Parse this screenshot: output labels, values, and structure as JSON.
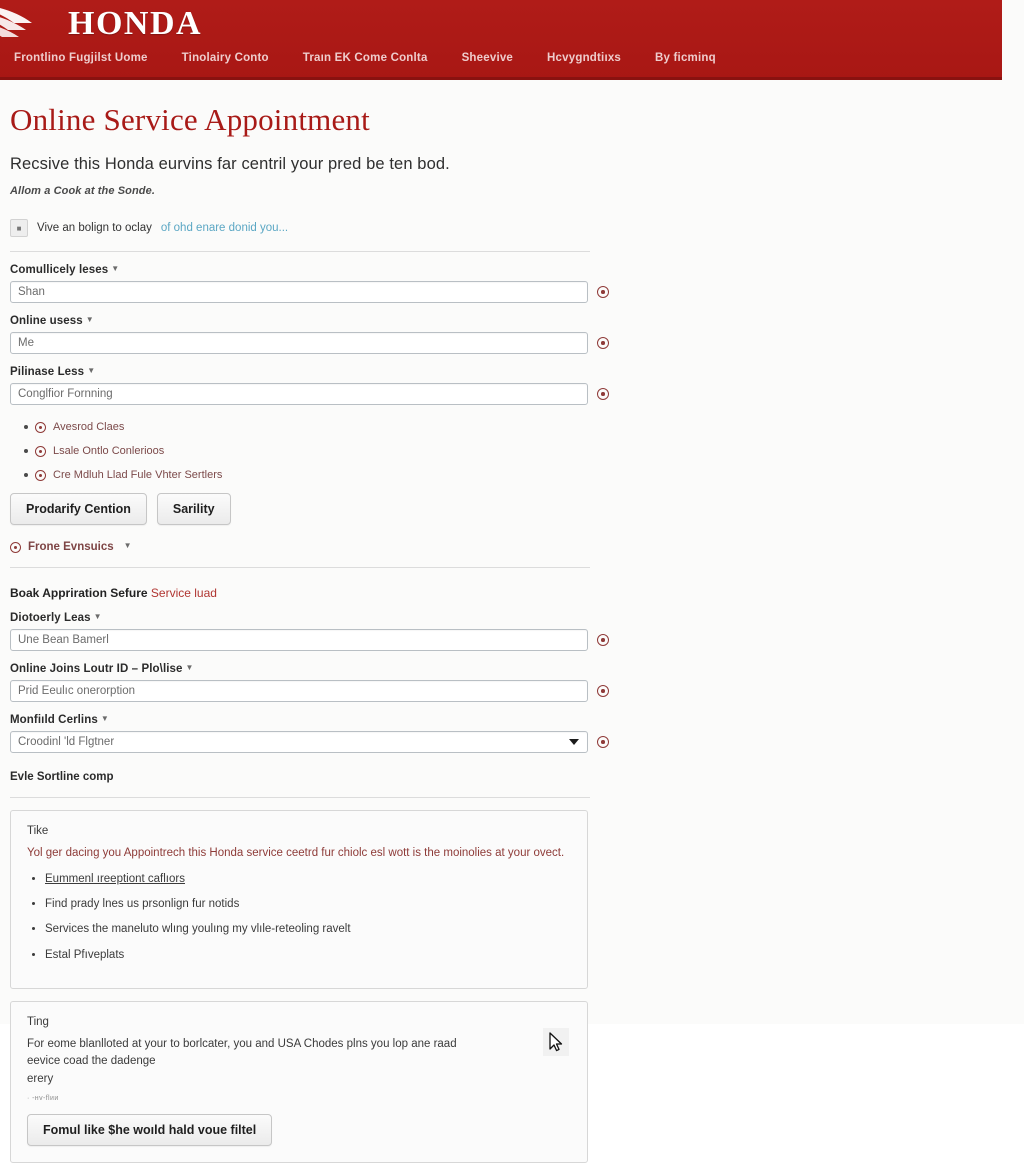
{
  "header": {
    "brand": "HONDA",
    "logo_icon": "honda-wing-logo",
    "brand_color": "#ad1917",
    "nav": [
      {
        "label": "Frontlino Fugjilst Uome"
      },
      {
        "label": "Tinolairy Conto"
      },
      {
        "label": "Traın EK Come Conlta"
      },
      {
        "label": "Sheevive"
      },
      {
        "label": "Hcvygndtiıxs"
      },
      {
        "label": "By ficminq"
      }
    ]
  },
  "main": {
    "title": "Online Service Appointment",
    "lede": "Recsive this Honda eurvins far centril your pred be ten bod.",
    "sublede": "Allom a Cook at the Sonde.",
    "note": {
      "icon": "checkbox-icon",
      "text": "Vive an bolign to oclay",
      "link": "of ohd enare donid you..."
    },
    "fields": [
      {
        "label": "Comullicely leses",
        "required_marker": "*",
        "value": "Shan",
        "type": "text",
        "action_icon": "target-dot-icon"
      },
      {
        "label": "Online usess",
        "required_marker": "*",
        "value": "Me",
        "type": "text",
        "action_icon": "target-dot-icon"
      },
      {
        "label": "Pilinase Less",
        "required_marker": "*",
        "value": "Conglfior Fornning",
        "type": "text",
        "action_icon": "target-dot-icon"
      }
    ],
    "options": [
      {
        "label": "Avesrod Claes"
      },
      {
        "label": "Lsale Ontlo Conlerioos"
      },
      {
        "label": "Cre Mdluh Llad Fule Vhter Sertlers"
      }
    ],
    "buttons": [
      {
        "label": "Prodarify Cention"
      },
      {
        "label": "Sarility"
      }
    ],
    "legend": {
      "icon": "target-dot-icon",
      "label": "Frone Evnsuics",
      "caret": "▾"
    },
    "section_head": {
      "text": "Boak Appriration Sefure ",
      "accent": "Service luad"
    },
    "fields2": [
      {
        "label": "Diotoerly Leas",
        "required_marker": "*",
        "value": "Une Bean Bamerl",
        "type": "text",
        "action_icon": "target-dot-icon"
      },
      {
        "label": "Online Joins Loutr ID – Plo\\lise",
        "required_marker": "*",
        "value": "Prid Eeulıc onerorption",
        "type": "text",
        "action_icon": "target-dot-icon"
      },
      {
        "label": "Monfiıld Cerlins",
        "required_marker": "*",
        "value": "Croodinl 'ld Flgtner",
        "type": "select",
        "action_icon": "target-dot-icon"
      }
    ],
    "subsection_title": "Evle Sortline comp",
    "info_panel": {
      "kicker": "Tike",
      "lead": "Yol ger dacing you Appointrech this Honda service ceetrd fur chiolc esl wott is the moinolies at your ovect.",
      "items": [
        {
          "label": "Eummenl ıreeptiont caflıors",
          "is_link": true
        },
        {
          "label": "Find prady lnes us prsonlign fur notids",
          "is_link": false
        },
        {
          "label": "Services the maneluto wlıng youlıng my vlıle-reteoling ravelt",
          "is_link": false
        },
        {
          "label": "Estal Pfıveplats",
          "is_link": false
        }
      ]
    },
    "bottom_panel": {
      "kicker": "Ting",
      "body_line1": "For eome blanlloted at your to borlcater, you and USA Chodes plns you lop ane raad",
      "body_line2": "eevice coad the dadenge",
      "body_line3": "erery",
      "tiny": "· ‑нv‑flии",
      "cursor_icon": "mouse-pointer-icon",
      "button": "Fomul like $he woıld hald voue filtel"
    }
  }
}
